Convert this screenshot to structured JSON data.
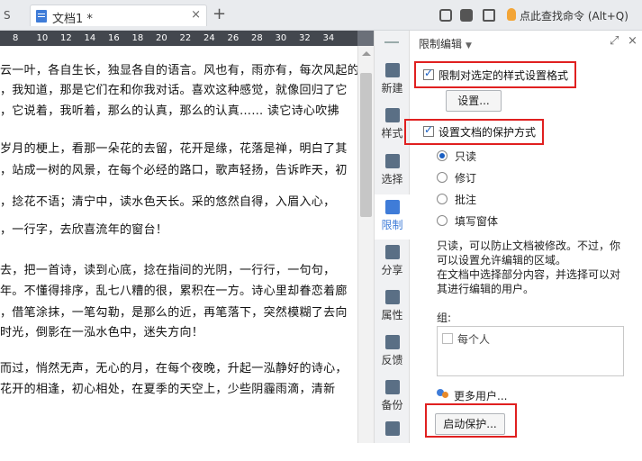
{
  "titlebar": {
    "prev_tab_fragment": "S",
    "tab_label": "文档1 *",
    "tab_close": "×",
    "add_tab": "+",
    "search_command": "点此查找命令 (Alt+Q)"
  },
  "ruler": {
    "ticks": [
      "8",
      "10",
      "12",
      "14",
      "16",
      "18",
      "20",
      "22",
      "24",
      "26",
      "28",
      "30",
      "32",
      "34"
    ]
  },
  "document": {
    "lines": [
      "云一叶，各自生长，独显各自的语言。风也有，雨亦有，每次风起的",
      "，我知道，那是它们在和你我对话。喜欢这种感觉，就像回归了它",
      "，它说着，我听着，那么的认真，那么的认真……  读它诗心吹拂",
      "岁月的梗上，看那一朵花的去留，花开是缘，花落是禅，明白了其",
      "，站成一树的风景，在每个必经的路口，歌声轻扬，告诉昨天，初",
      "，捻花不语；清宁中，读水色天长。采的悠然自得，入眉入心，",
      "，一行字，去欣喜流年的窗台！",
      "去，把一首诗，读到心底，捻在指间的光阴，一行行，一句句，",
      "年。不懂得排序，乱七八糟的很，累积在一方。诗心里却眷恋着廊",
      "，借笔涂抹，一笔勾勒，是那么的近，再笔落下，突然模糊了去向",
      "时光，倒影在一泓水色中，迷失方向！",
      "而过，悄然无声，无心的月，在每个夜晚，升起一泓静好的诗心，",
      "花开的相逢，初心相处，在夏季的天空上，少些阴霾雨滴，清新"
    ]
  },
  "sidebar": {
    "items": [
      {
        "label": "新建",
        "icon": "new-icon"
      },
      {
        "label": "样式",
        "icon": "style-icon"
      },
      {
        "label": "选择",
        "icon": "select-icon"
      },
      {
        "label": "限制",
        "icon": "restrict-icon"
      },
      {
        "label": "分享",
        "icon": "share-icon"
      },
      {
        "label": "属性",
        "icon": "properties-icon"
      },
      {
        "label": "反馈",
        "icon": "feedback-icon"
      },
      {
        "label": "备份",
        "icon": "backup-icon"
      },
      {
        "label": "",
        "icon": "more-icon"
      }
    ],
    "active_index": 3
  },
  "panel": {
    "title": "限制编辑",
    "restrict_format_label": "限制对选定的样式设置格式",
    "restrict_format_checked": true,
    "settings_button": "设置...",
    "protect_label": "设置文档的保护方式",
    "protect_checked": true,
    "radio_options": [
      "只读",
      "修订",
      "批注",
      "填写窗体"
    ],
    "radio_selected": 0,
    "description": "只读，可以防止文档被修改。不过，你可以设置允许编辑的区域。在文档中选择部分内容，并选择可以对其进行编辑的用户。",
    "desc_line1": "只读，可以防止文档被修改。不过，你",
    "desc_line2": "可以设置允许编辑的区域。",
    "desc_line3": "在文档中选择部分内容，并选择可以对",
    "desc_line4": "其进行编辑的用户。",
    "group_label": "组:",
    "everyone_label": "每个人",
    "more_users": "更多用户...",
    "start_protect_button": "启动保护..."
  },
  "colors": {
    "highlight_box": "#e02020",
    "accent": "#3f7cd8",
    "ruler_bg": "#43474e"
  }
}
